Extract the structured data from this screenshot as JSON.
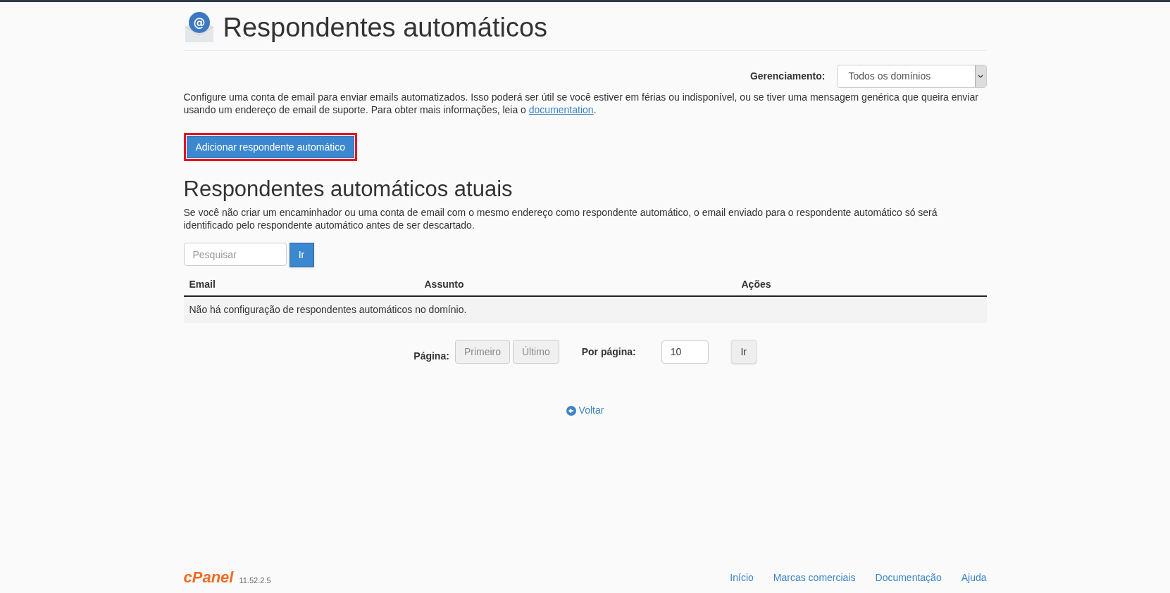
{
  "header": {
    "title": "Respondentes automáticos",
    "icon_glyph": "@"
  },
  "management": {
    "label": "Gerenciamento:",
    "value": "Todos os domínios"
  },
  "description": {
    "text": "Configure uma conta de email para enviar emails automatizados. Isso poderá ser útil se você estiver em férias ou indisponível, ou se tiver uma mensagem genérica que queira enviar usando um endereço de email de suporte. Para obter mais informações, leia o ",
    "link": "documentation",
    "after": "."
  },
  "add_button": {
    "label": "Adicionar respondente automático",
    "highlighted": true
  },
  "current": {
    "title": "Respondentes automáticos atuais",
    "note": "Se você não criar um encaminhador ou uma conta de email com o mesmo endereço como respondente automático, o email enviado para o respondente automático só será identificado pelo respondente automático antes de ser descartado."
  },
  "search": {
    "placeholder": "Pesquisar",
    "button": "Ir"
  },
  "table": {
    "columns": [
      "Email",
      "Assunto",
      "Ações"
    ],
    "empty_message": "Não há configuração de respondentes automáticos no domínio."
  },
  "pagination": {
    "label": "Página:",
    "buttons": [
      {
        "label": "Primeiro",
        "disabled": true
      },
      {
        "label": "Último",
        "disabled": true
      }
    ],
    "per_page_label": "Por página:",
    "per_page_value": "10",
    "go": "Ir"
  },
  "back_link": "Voltar",
  "footer": {
    "logo": "cPanel",
    "version": "11.52.2.5",
    "links": [
      "Início",
      "Marcas comerciais",
      "Documentação",
      "Ajuda"
    ]
  }
}
